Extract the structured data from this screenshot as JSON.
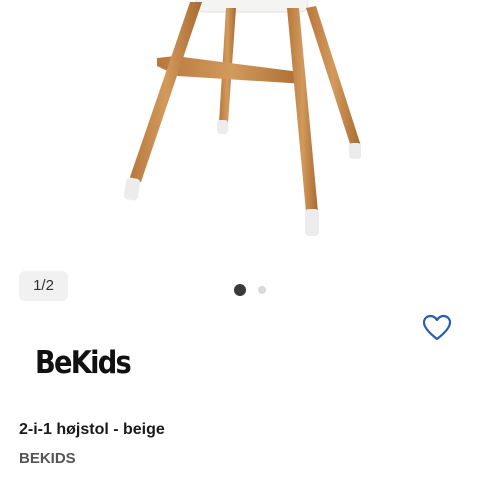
{
  "gallery": {
    "counter": "1/2",
    "dots": [
      "active",
      "inactive"
    ],
    "image_name": "high-chair-product-image"
  },
  "favorite": {
    "icon": "heart-outline-icon",
    "color": "#2a5db0"
  },
  "brand_logo": {
    "text": "BeKids"
  },
  "product": {
    "title": "2-i-1 højstol - beige",
    "brand": "BEKIDS"
  }
}
